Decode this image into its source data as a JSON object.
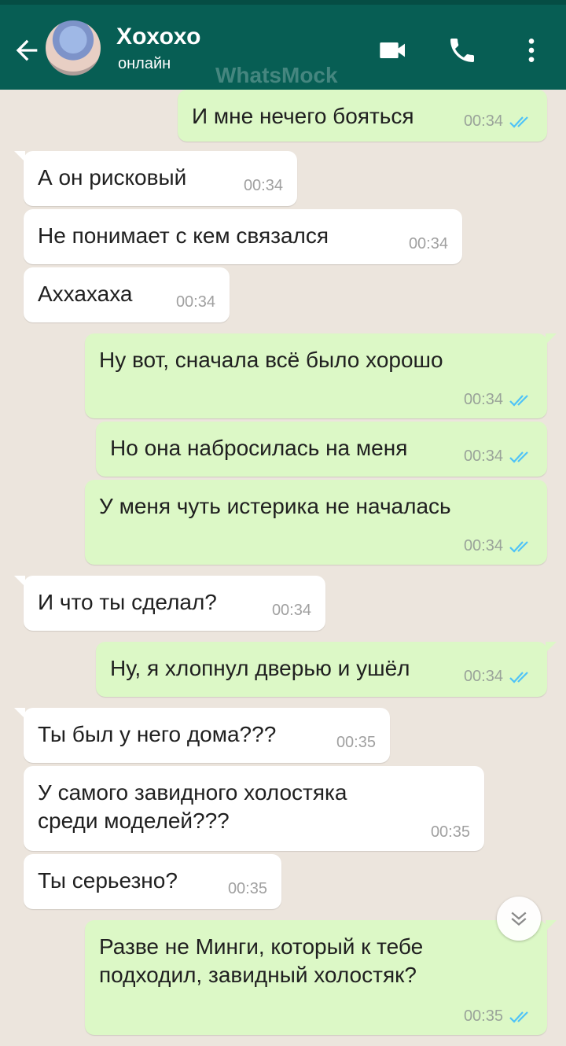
{
  "header": {
    "contact_name": "Хохохо",
    "status": "онлайн",
    "watermark": "WhatsMock",
    "icons": [
      "back-arrow-icon",
      "video-call-icon",
      "phone-icon",
      "more-vert-icon"
    ]
  },
  "colors": {
    "header_bg": "#075e54",
    "chat_bg": "#ece5dd",
    "incoming_bubble": "#ffffff",
    "outgoing_bubble": "#dcf8c6",
    "read_ticks": "#4fc3f7"
  },
  "messages": [
    {
      "direction": "out",
      "text": "И мне нечего бояться",
      "time": "00:34",
      "read": true
    },
    {
      "direction": "in",
      "text": "А он рисковый",
      "time": "00:34"
    },
    {
      "direction": "in",
      "text": "Не понимает с кем связался",
      "time": "00:34"
    },
    {
      "direction": "in",
      "text": "Аххахаха",
      "time": "00:34"
    },
    {
      "direction": "out",
      "text": "Ну вот, сначала всё было хорошо",
      "time": "00:34",
      "read": true
    },
    {
      "direction": "out",
      "text": "Но она набросилась на меня",
      "time": "00:34",
      "read": true
    },
    {
      "direction": "out",
      "text": "У меня чуть истерика не началась",
      "time": "00:34",
      "read": true
    },
    {
      "direction": "in",
      "text": "И что ты сделал?",
      "time": "00:34"
    },
    {
      "direction": "out",
      "text": "Ну, я хлопнул дверью и ушёл",
      "time": "00:34",
      "read": true
    },
    {
      "direction": "in",
      "text": "Ты был у него дома???",
      "time": "00:35"
    },
    {
      "direction": "in",
      "text": "У самого завидного холостяка\nсреди моделей???",
      "time": "00:35"
    },
    {
      "direction": "in",
      "text": "Ты серьезно?",
      "time": "00:35"
    },
    {
      "direction": "out",
      "text": "Разве не Минги, который к тебе\nподходил, завидный холостяк?",
      "time": "00:35",
      "read": true
    }
  ],
  "scroll_down_icon": "chevron-double-down-icon"
}
